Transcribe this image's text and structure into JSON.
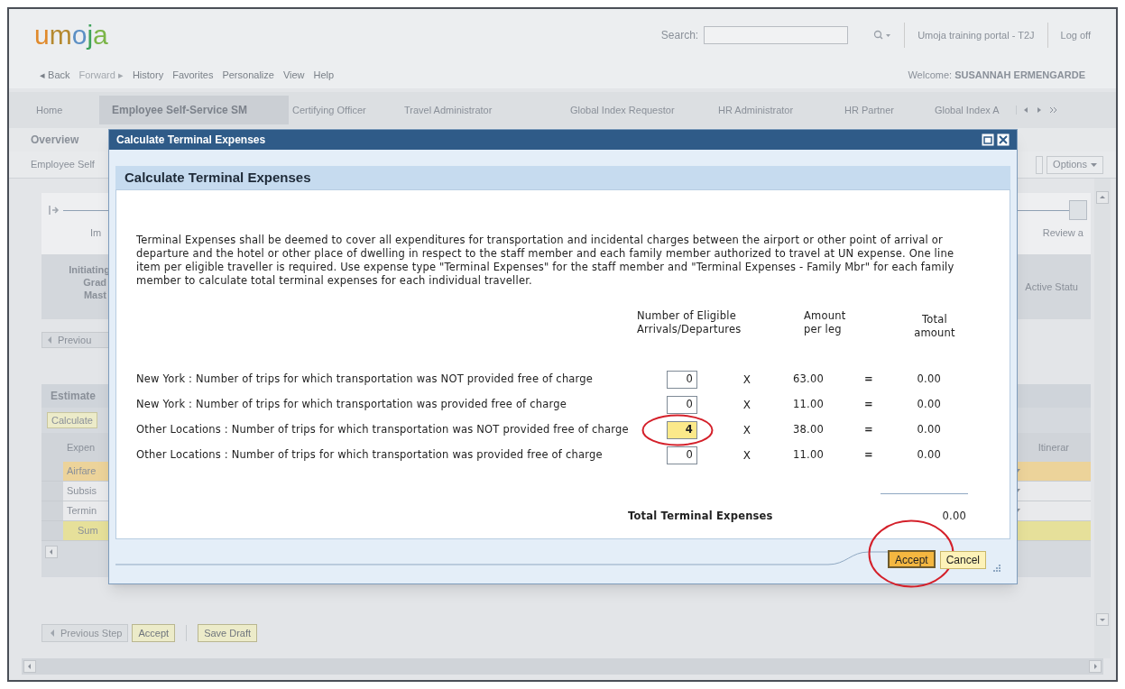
{
  "header": {
    "logo": "umoja",
    "search_label": "Search:",
    "portal": "Umoja training portal - T2J",
    "logoff": "Log off"
  },
  "nav": [
    {
      "label": "◂ Back",
      "disabled": false
    },
    {
      "label": "Forward ▸",
      "disabled": true
    },
    {
      "label": "History",
      "disabled": false
    },
    {
      "label": "Favorites",
      "disabled": false
    },
    {
      "label": "Personalize",
      "disabled": false
    },
    {
      "label": "View",
      "disabled": false
    },
    {
      "label": "Help",
      "disabled": false
    }
  ],
  "welcome": {
    "label": "Welcome:",
    "name": "SUSANNAH ERMENGARDE"
  },
  "tabs": [
    {
      "label": "Home",
      "selected": false
    },
    {
      "label": "Employee Self-Service SM",
      "selected": true
    },
    {
      "label": "Certifying Officer",
      "selected": false
    },
    {
      "label": "Travel Administrator",
      "selected": false
    },
    {
      "label": "Global Index Requestor",
      "selected": false
    },
    {
      "label": "HR Administrator",
      "selected": false
    },
    {
      "label": "HR Partner",
      "selected": false
    },
    {
      "label": "Global Index A",
      "selected": false
    }
  ],
  "page": {
    "subtab": "Overview",
    "breadcrumb": "Employee Self",
    "options_menu": "Options",
    "roadmap": {
      "step_left": "Im",
      "step_right": "Review a"
    },
    "header_fields": [
      "Initiating",
      "Grad",
      "Mast"
    ],
    "active_status": "Active Statu",
    "previous_button": "Previou",
    "estimate": {
      "title": "Estimate",
      "calculate_button": "Calculate",
      "columns": [
        "Expen",
        "Itinerar"
      ],
      "rows": [
        {
          "label": "Airfare",
          "selected": true,
          "kind": "item"
        },
        {
          "label": "Subsis",
          "selected": false,
          "kind": "item"
        },
        {
          "label": "Termin",
          "selected": false,
          "kind": "item"
        },
        {
          "label": "Sum",
          "selected": false,
          "kind": "sum"
        }
      ]
    },
    "bottom_buttons": [
      {
        "label": "Previous Step",
        "disabled": true
      },
      {
        "label": "Accept",
        "disabled": false
      },
      {
        "label": "Save Draft",
        "disabled": false
      }
    ]
  },
  "dialog": {
    "title": "Calculate Terminal Expenses",
    "heading": "Calculate Terminal Expenses",
    "description": "Terminal Expenses shall be deemed to cover all expenditures for transportation and incidental charges between the airport or other point of arrival or departure and the hotel or other place of dwelling in respect to the staff member and each family member authorized to travel at UN expense. One line item per eligible traveller is required. Use expense type \"Terminal Expenses\" for the staff member and \"Terminal Expenses - Family Mbr\" for each family member to calculate total terminal expenses for each individual traveller.",
    "columns": [
      "Number of Eligible Arrivals/Departures",
      "Amount per leg",
      "Total amount"
    ],
    "rows": [
      {
        "label": "New York : Number of trips for which transportation was NOT provided free of charge",
        "count": "0",
        "highlighted": false,
        "circled": false,
        "times": "X",
        "rate": "63.00",
        "equals": "=",
        "total": "0.00"
      },
      {
        "label": "New York : Number of trips for which transportation was provided free of charge",
        "count": "0",
        "highlighted": false,
        "circled": false,
        "times": "X",
        "rate": "11.00",
        "equals": "=",
        "total": "0.00"
      },
      {
        "label": "Other Locations : Number of trips for which transportation was NOT provided free of charge",
        "count": "4",
        "highlighted": true,
        "circled": true,
        "times": "X",
        "rate": "38.00",
        "equals": "=",
        "total": "0.00"
      },
      {
        "label": "Other Locations : Number of trips for which transportation was provided free of charge",
        "count": "0",
        "highlighted": false,
        "circled": false,
        "times": "X",
        "rate": "11.00",
        "equals": "=",
        "total": "0.00"
      }
    ],
    "total_label": "Total Terminal Expenses",
    "total_value": "0.00",
    "buttons": [
      {
        "label": "Accept",
        "primary": true,
        "circled": true
      },
      {
        "label": "Cancel",
        "primary": false,
        "circled": false
      }
    ]
  }
}
